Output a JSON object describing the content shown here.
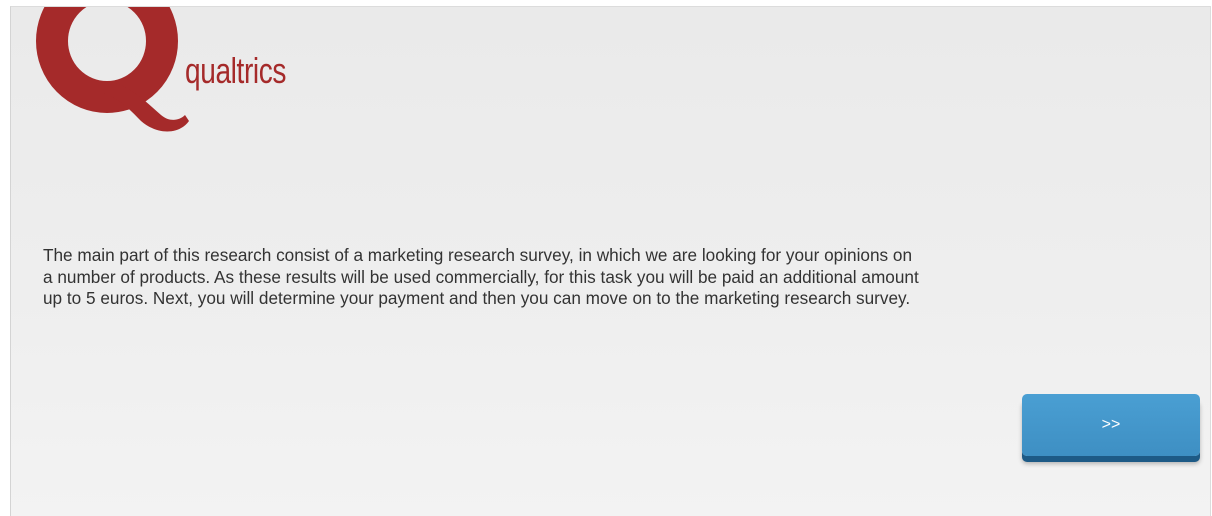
{
  "header": {
    "logo_text": "qualtrics",
    "logo_icon": "qualtrics-q-logo",
    "brand_color": "#a52a2a"
  },
  "main": {
    "intro_text": "The main part of this research consist of a marketing research survey, in which we are looking for your opinions on\na number of products.  As these results will be used commercially, for this task you will be paid an additional amount\nup to 5 euros. Next, you will determine your payment and then you can  move on to the marketing research survey."
  },
  "navigation": {
    "next_label": ">>",
    "button_color": "#4a9fd3"
  }
}
